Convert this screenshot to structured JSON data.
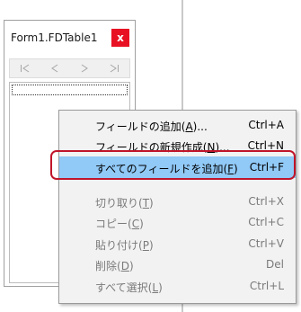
{
  "window": {
    "title": "Form1.FDTable1",
    "close_glyph": "x"
  },
  "navigator": {
    "buttons": [
      {
        "name": "first-record-button",
        "icon": "first-icon"
      },
      {
        "name": "prior-record-button",
        "icon": "prior-icon"
      },
      {
        "name": "next-record-button",
        "icon": "next-icon"
      },
      {
        "name": "last-record-button",
        "icon": "last-icon"
      }
    ]
  },
  "menu": {
    "items": [
      {
        "label": "フィールドの追加(",
        "accel": "A",
        "suffix": ")...",
        "shortcut": "Ctrl+A",
        "enabled": true,
        "highlighted": false
      },
      {
        "label": "フィールドの新規作成(",
        "accel": "N",
        "suffix": ")...",
        "shortcut": "Ctrl+N",
        "enabled": true,
        "highlighted": false
      },
      {
        "label": "すべてのフィールドを追加(",
        "accel": "F",
        "suffix": ")",
        "shortcut": "Ctrl+F",
        "enabled": true,
        "highlighted": true
      },
      {
        "label": "切り取り(",
        "accel": "T",
        "suffix": ")",
        "shortcut": "Ctrl+X",
        "enabled": false,
        "highlighted": false
      },
      {
        "label": "コピー(",
        "accel": "C",
        "suffix": ")",
        "shortcut": "Ctrl+C",
        "enabled": false,
        "highlighted": false
      },
      {
        "label": "貼り付け(",
        "accel": "P",
        "suffix": ")",
        "shortcut": "Ctrl+V",
        "enabled": false,
        "highlighted": false
      },
      {
        "label": "削除(",
        "accel": "D",
        "suffix": ")",
        "shortcut": "Del",
        "enabled": false,
        "highlighted": false
      },
      {
        "label": "すべて選択(",
        "accel": "L",
        "suffix": ")",
        "shortcut": "Ctrl+L",
        "enabled": false,
        "highlighted": false
      }
    ]
  },
  "colors": {
    "highlight": "#91c9f7",
    "callout_border": "#c0152a",
    "close_button": "#e81123"
  }
}
